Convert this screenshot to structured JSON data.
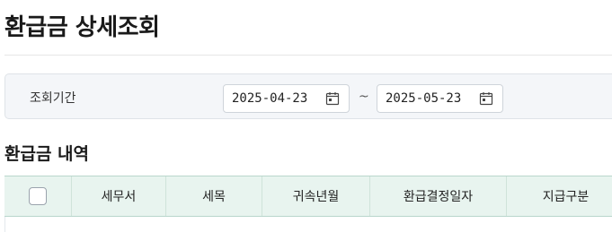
{
  "page": {
    "title": "환급금 상세조회"
  },
  "filter": {
    "label": "조회기간",
    "date_from": "2025-04-23",
    "date_to": "2025-05-23",
    "separator": "~",
    "icon": "calendar-icon"
  },
  "section": {
    "title": "환급금 내역"
  },
  "table": {
    "select_all_checked": false,
    "columns": [
      "세무서",
      "세목",
      "귀속년월",
      "환급결정일자",
      "지급구분"
    ],
    "rows": []
  }
}
